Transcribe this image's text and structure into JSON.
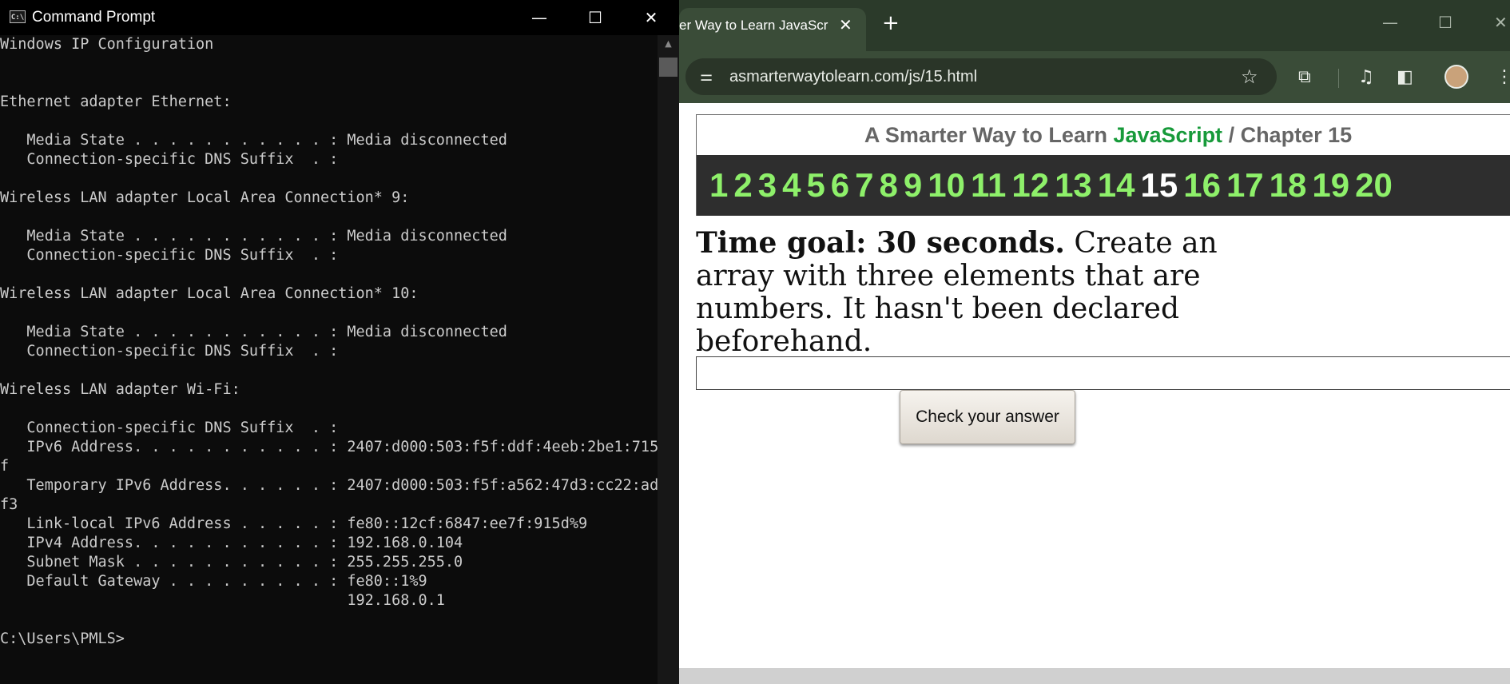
{
  "cmd": {
    "title": "Command Prompt",
    "icon_label": "C:\\",
    "lines": [
      "Windows IP Configuration",
      "",
      "",
      "Ethernet adapter Ethernet:",
      "",
      "   Media State . . . . . . . . . . . : Media disconnected",
      "   Connection-specific DNS Suffix  . :",
      "",
      "Wireless LAN adapter Local Area Connection* 9:",
      "",
      "   Media State . . . . . . . . . . . : Media disconnected",
      "   Connection-specific DNS Suffix  . :",
      "",
      "Wireless LAN adapter Local Area Connection* 10:",
      "",
      "   Media State . . . . . . . . . . . : Media disconnected",
      "   Connection-specific DNS Suffix  . :",
      "",
      "Wireless LAN adapter Wi-Fi:",
      "",
      "   Connection-specific DNS Suffix  . :",
      "   IPv6 Address. . . . . . . . . . . : 2407:d000:503:f5f:ddf:4eeb:2be1:715",
      "f",
      "   Temporary IPv6 Address. . . . . . : 2407:d000:503:f5f:a562:47d3:cc22:ad",
      "f3",
      "   Link-local IPv6 Address . . . . . : fe80::12cf:6847:ee7f:915d%9",
      "   IPv4 Address. . . . . . . . . . . : 192.168.0.104",
      "   Subnet Mask . . . . . . . . . . . : 255.255.255.0",
      "   Default Gateway . . . . . . . . . : fe80::1%9",
      "                                       192.168.0.1",
      "",
      "C:\\Users\\PMLS>"
    ]
  },
  "chrome": {
    "tab_title": "er Way to Learn JavaScr",
    "url": "asmarterwaytolearn.com/js/15.html",
    "icons": {
      "site_info": "⚌",
      "star": "☆",
      "extensions": "⧉",
      "media": "♫",
      "side_panel": "◧",
      "menu": "⋮",
      "close": "✕",
      "new_tab": "+",
      "minimize": "—",
      "maximize": "☐"
    }
  },
  "page": {
    "header_prefix": "A Smarter Way to Learn ",
    "header_brand": "JavaScript",
    "header_suffix": "  /  Chapter 15",
    "chapters": [
      "1",
      "2",
      "3",
      "4",
      "5",
      "6",
      "7",
      "8",
      "9",
      "10",
      "11",
      "12",
      "13",
      "14",
      "15",
      "16",
      "17",
      "18",
      "19",
      "20"
    ],
    "current_chapter": "15",
    "question_bold": "Time goal: 30 seconds.",
    "question_text": " Create an array with three elements that are numbers. It hasn't been declared beforehand.",
    "answer_value": "",
    "check_button": "Check your answer",
    "colors": {
      "brand_green": "#179a3a",
      "chapter_green": "#8ef06a",
      "chapter_bar": "#2e2e2e"
    }
  }
}
